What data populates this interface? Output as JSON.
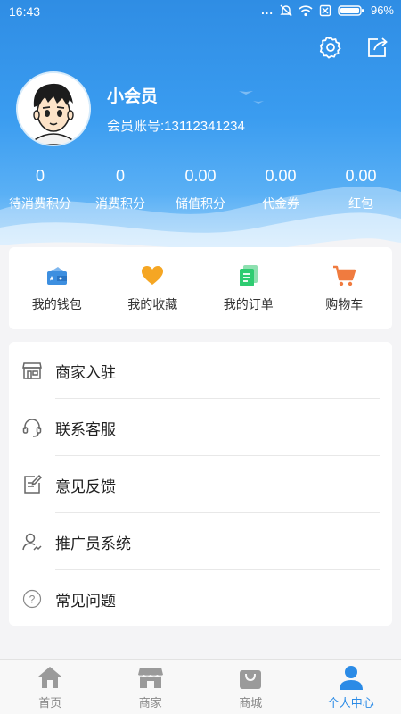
{
  "status_bar": {
    "time": "16:43",
    "battery": "96%",
    "dots": "..."
  },
  "profile": {
    "nickname": "小会员",
    "account": "会员账号:13112341234"
  },
  "stats": [
    {
      "value": "0",
      "label": "待消费积分"
    },
    {
      "value": "0",
      "label": "消费积分"
    },
    {
      "value": "0.00",
      "label": "储值积分"
    },
    {
      "value": "0.00",
      "label": "代金券"
    },
    {
      "value": "0.00",
      "label": "红包"
    }
  ],
  "quick_links": [
    {
      "label": "我的钱包",
      "icon": "wallet-icon",
      "color": "#3d8fe0"
    },
    {
      "label": "我的收藏",
      "icon": "heart-icon",
      "color": "#f5a623"
    },
    {
      "label": "我的订单",
      "icon": "order-icon",
      "color": "#2ecc71"
    },
    {
      "label": "购物车",
      "icon": "cart-icon",
      "color": "#f07b3f"
    }
  ],
  "menu": [
    {
      "label": "商家入驻",
      "icon": "store-icon"
    },
    {
      "label": "联系客服",
      "icon": "headset-icon"
    },
    {
      "label": "意见反馈",
      "icon": "feedback-icon"
    },
    {
      "label": "推广员系统",
      "icon": "promoter-icon"
    },
    {
      "label": "常见问题",
      "icon": "question-icon"
    }
  ],
  "tabs": [
    {
      "label": "首页",
      "icon": "home-icon",
      "active": false
    },
    {
      "label": "商家",
      "icon": "shop-icon",
      "active": false
    },
    {
      "label": "商城",
      "icon": "bag-icon",
      "active": false
    },
    {
      "label": "个人中心",
      "icon": "person-icon",
      "active": true
    }
  ],
  "colors": {
    "header_blue": "#2f8de4",
    "active_tab": "#2b8be6",
    "inactive_tab": "#888888"
  }
}
